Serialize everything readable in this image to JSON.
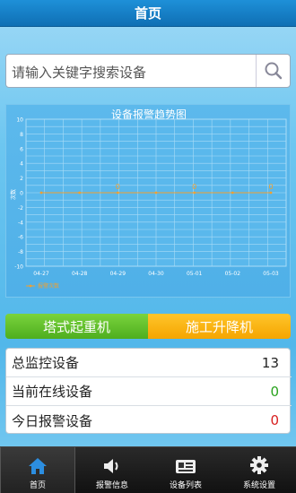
{
  "header": {
    "title": "首页"
  },
  "search": {
    "placeholder": "请输入关键字搜索设备"
  },
  "chart_data": {
    "type": "line",
    "title": "设备报警趋势图",
    "ylabel": "次数",
    "xlabel": "",
    "x": [
      "04-27",
      "04-28",
      "04-29",
      "04-30",
      "05-01",
      "05-02",
      "05-03"
    ],
    "yticks": [
      "10",
      "8",
      "6",
      "4",
      "2",
      "0",
      "-2",
      "-4",
      "-6",
      "-8",
      "-10"
    ],
    "ylim": [
      -10,
      10
    ],
    "grid": true,
    "legend_position": "bottom-left",
    "series": [
      {
        "name": "报警次数",
        "values": [
          0,
          0,
          0,
          0,
          0,
          0,
          0
        ],
        "point_labels": [
          "",
          "",
          "0",
          "",
          "0",
          "",
          "0"
        ]
      }
    ],
    "colors": {
      "line": "#f0a030",
      "grid": "#a9dcf7",
      "text": "#ffffff"
    }
  },
  "tabs": {
    "crane": "塔式起重机",
    "lift": "施工升降机"
  },
  "stats": [
    {
      "label": "总监控设备",
      "value": "13",
      "color": "#222222"
    },
    {
      "label": "当前在线设备",
      "value": "0",
      "color": "#2aa31e"
    },
    {
      "label": "今日报警设备",
      "value": "0",
      "color": "#d82020"
    }
  ],
  "nav": [
    {
      "label": "首页",
      "icon": "home-icon"
    },
    {
      "label": "报警信息",
      "icon": "speaker-icon"
    },
    {
      "label": "设备列表",
      "icon": "device-card-icon"
    },
    {
      "label": "系统设置",
      "icon": "gear-icon"
    }
  ]
}
